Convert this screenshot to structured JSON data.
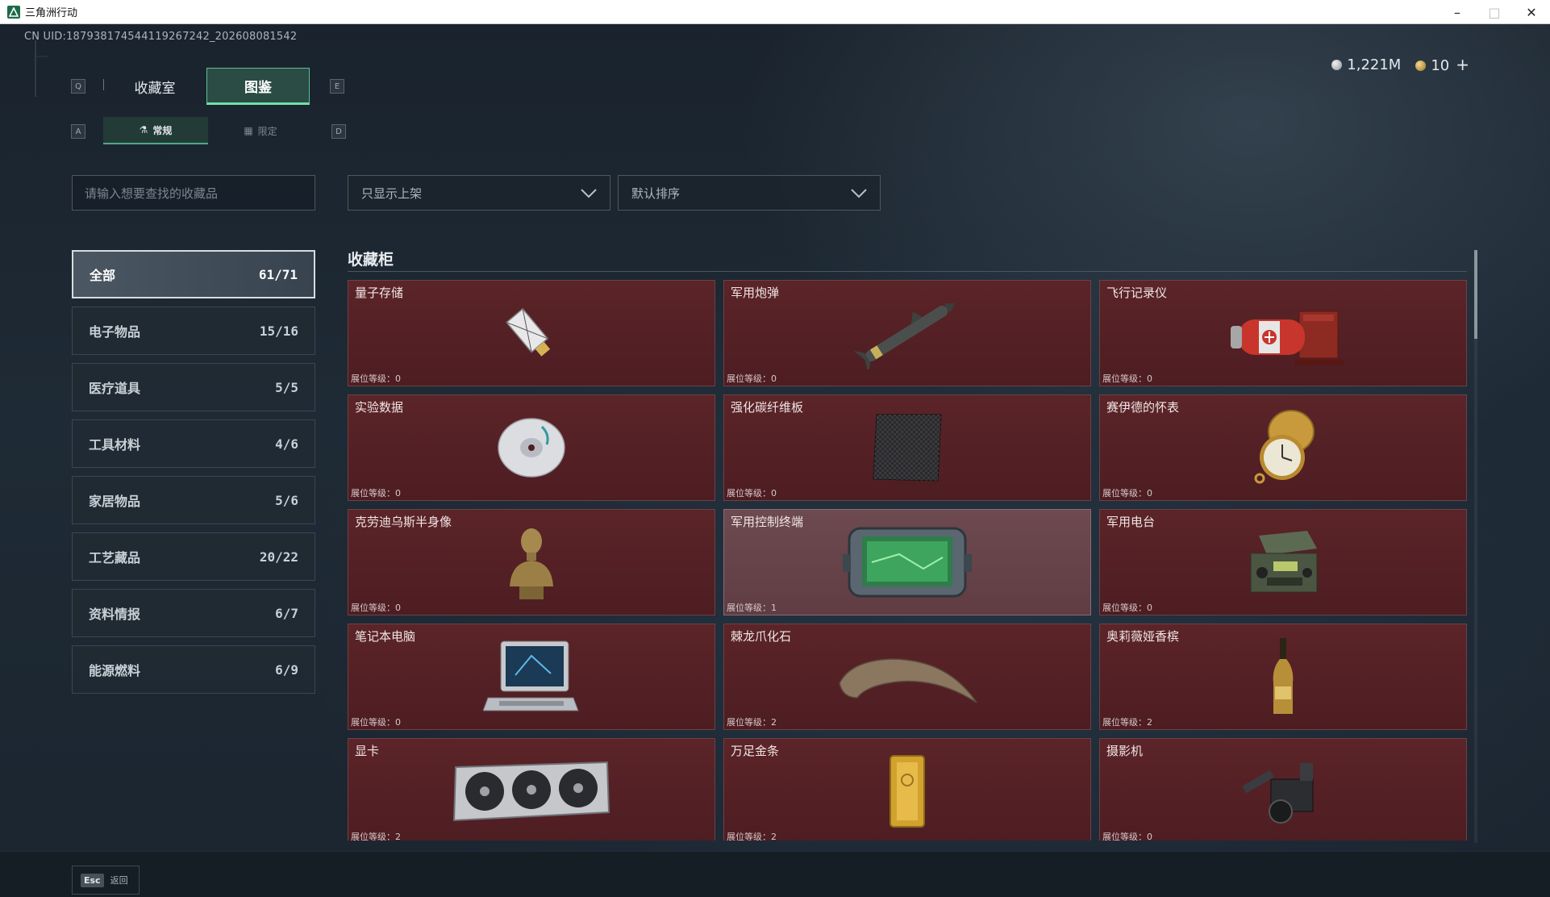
{
  "window": {
    "title": "三角洲行动",
    "controls": [
      "minimize",
      "maximize",
      "close"
    ]
  },
  "uid": "CN UID:187938174544119267242_202608081542",
  "currency": {
    "silver": "1,221M",
    "gold": "10",
    "plus": "+"
  },
  "tabs": {
    "main": [
      {
        "label": "收藏室",
        "active": false
      },
      {
        "label": "图鉴",
        "active": true
      }
    ],
    "left_key": "Q",
    "right_key": "E",
    "sub": [
      {
        "label": "常规",
        "active": true
      },
      {
        "label": "限定",
        "active": false
      }
    ],
    "sub_left_key": "A",
    "sub_right_key": "D"
  },
  "search": {
    "placeholder": "请输入想要查找的收藏品"
  },
  "filters": {
    "filter_label": "只显示上架",
    "sort_label": "默认排序"
  },
  "categories": [
    {
      "label": "全部",
      "count": "61/71",
      "active": true
    },
    {
      "label": "电子物品",
      "count": "15/16"
    },
    {
      "label": "医疗道具",
      "count": "5/5"
    },
    {
      "label": "工具材料",
      "count": "4/6"
    },
    {
      "label": "家居物品",
      "count": "5/6"
    },
    {
      "label": "工艺藏品",
      "count": "20/22"
    },
    {
      "label": "资料情报",
      "count": "6/7"
    },
    {
      "label": "能源燃料",
      "count": "6/9"
    }
  ],
  "section_title": "收藏柜",
  "items": [
    {
      "name": "量子存储",
      "level": "展位等级：0",
      "icon": "usb-drive-icon"
    },
    {
      "name": "军用炮弹",
      "level": "展位等级：0",
      "icon": "missile-icon"
    },
    {
      "name": "飞行记录仪",
      "level": "展位等级：0",
      "icon": "flight-recorder-icon"
    },
    {
      "name": "实验数据",
      "level": "展位等级：0",
      "icon": "disc-icon"
    },
    {
      "name": "强化碳纤维板",
      "level": "展位等级：0",
      "icon": "carbon-plate-icon"
    },
    {
      "name": "赛伊德的怀表",
      "level": "展位等级：0",
      "icon": "pocket-watch-icon"
    },
    {
      "name": "克劳迪乌斯半身像",
      "level": "展位等级：0",
      "icon": "bust-icon"
    },
    {
      "name": "军用控制终端",
      "level": "展位等级：1",
      "icon": "control-terminal-icon",
      "highlight": true
    },
    {
      "name": "军用电台",
      "level": "展位等级：0",
      "icon": "radio-icon"
    },
    {
      "name": "笔记本电脑",
      "level": "展位等级：0",
      "icon": "laptop-icon"
    },
    {
      "name": "棘龙爪化石",
      "level": "展位等级：2",
      "icon": "claw-fossil-icon"
    },
    {
      "name": "奥莉薇娅香槟",
      "level": "展位等级：2",
      "icon": "champagne-icon"
    },
    {
      "name": "显卡",
      "level": "展位等级：2",
      "icon": "graphics-card-icon"
    },
    {
      "name": "万足金条",
      "level": "展位等级：2",
      "icon": "gold-bar-icon"
    },
    {
      "name": "摄影机",
      "level": "展位等级：0",
      "icon": "camera-icon"
    }
  ],
  "footer": {
    "esc_key": "Esc",
    "back_label": "返回"
  }
}
